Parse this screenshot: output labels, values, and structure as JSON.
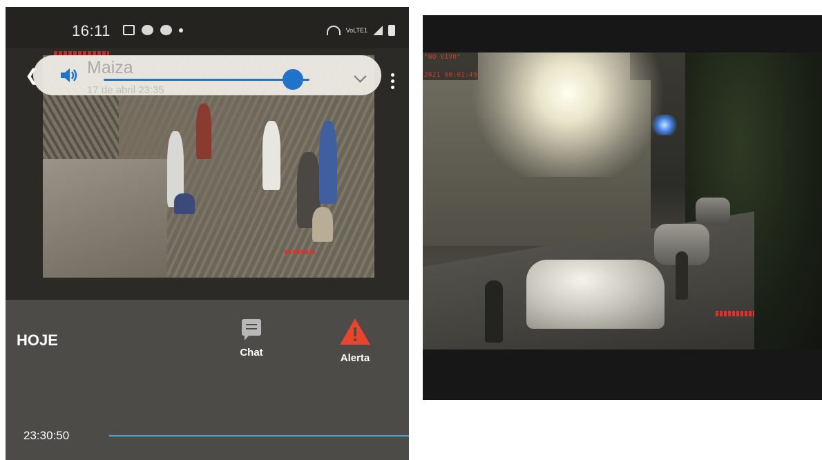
{
  "status_bar": {
    "time": "16:11",
    "network_label": "VoLTE1"
  },
  "call_overlay": {
    "contact_name": "Maiza",
    "date": "17 de abril 23:35",
    "volume_level_percent": 92
  },
  "events": {
    "day_label": "HOJE",
    "chat_label": "Chat",
    "alert_label": "Alerta",
    "first_time": "23:30:50"
  },
  "cctv": {
    "camera_label": "\"NO VIVO\"",
    "timestamp": "2021 00:01:49"
  },
  "colors": {
    "accent_blue": "#1f73c9",
    "alert_red": "#e8452c",
    "timeline_blue": "#4f9fd0"
  }
}
